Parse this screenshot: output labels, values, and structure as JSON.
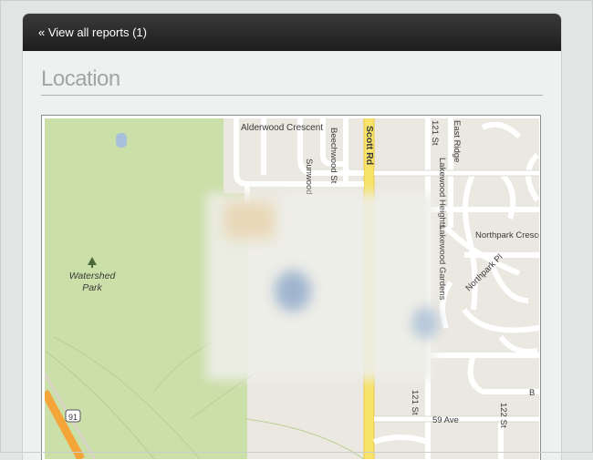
{
  "nav": {
    "back_link": "« View all reports (1)"
  },
  "section": {
    "title": "Location"
  },
  "map": {
    "park_name_line1": "Watershed",
    "park_name_line2": "Park",
    "streets": {
      "alderwood": "Alderwood Crescent",
      "sunwood": "Sunwood",
      "beechwood": "Beechwood St",
      "scott_rd": "Scott Rd",
      "st121_top": "121 St",
      "east_ridge": "East Ridge",
      "lakewood_heights": "Lakewood Heights",
      "lakewood_gardens": "Lakewood Gardens",
      "northpark_crescent": "Northpark Crescent",
      "northpark_pl": "Northpark Pl",
      "st121_bottom": "121 St",
      "ave59": "59 Ave",
      "st122": "122 St",
      "b_partial": "B",
      "hwy91": "91"
    },
    "colors": {
      "park": "#cbdfa8",
      "road": "#ffffff",
      "highlighted_road": "#f7e36a",
      "highway": "#f3a53a",
      "land": "#ebe8e1",
      "water": "#a8c0dc"
    }
  }
}
